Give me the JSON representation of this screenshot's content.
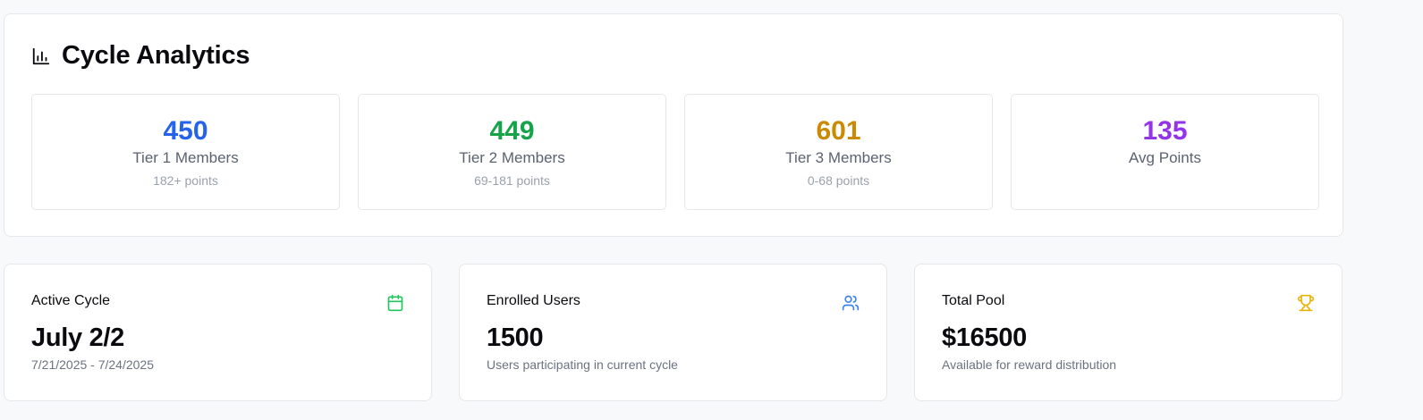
{
  "analytics": {
    "title": "Cycle Analytics",
    "icon": "bar-chart-icon",
    "tiers": [
      {
        "value": "450",
        "label": "Tier 1 Members",
        "sub": "182+ points",
        "color": "#2563eb"
      },
      {
        "value": "449",
        "label": "Tier 2 Members",
        "sub": "69-181 points",
        "color": "#16a34a"
      },
      {
        "value": "601",
        "label": "Tier 3 Members",
        "sub": "0-68 points",
        "color": "#ca8a04"
      },
      {
        "value": "135",
        "label": "Avg Points",
        "sub": "",
        "color": "#9333ea"
      }
    ]
  },
  "stats": [
    {
      "title": "Active Cycle",
      "value": "July 2/2",
      "desc": "7/21/2025 - 7/24/2025",
      "icon": "calendar-icon",
      "icon_color": "#22c55e"
    },
    {
      "title": "Enrolled Users",
      "value": "1500",
      "desc": "Users participating in current cycle",
      "icon": "users-icon",
      "icon_color": "#3b82f6"
    },
    {
      "title": "Total Pool",
      "value": "$16500",
      "desc": "Available for reward distribution",
      "icon": "trophy-icon",
      "icon_color": "#eab308"
    }
  ]
}
